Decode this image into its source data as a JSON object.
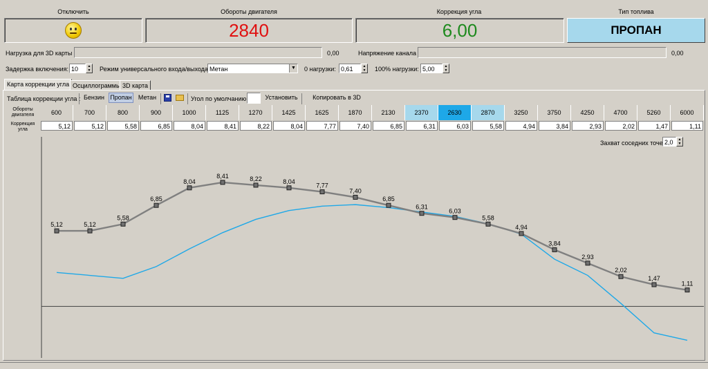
{
  "top": {
    "disable_label": "Отключить",
    "rpm_label": "Обороты двигателя",
    "rpm_value": "2840",
    "correction_label": "Коррекция угла",
    "correction_value": "6,00",
    "fuel_label": "Тип топлива",
    "fuel_value": "ПРОПАН"
  },
  "colors": {
    "rpm": "#e01010",
    "correction": "#1e8a1e",
    "fuel_bg": "#a6d8ec",
    "accent": "#1ea8e8",
    "curve_set": "#808080",
    "curve_actual": "#1ea8e8"
  },
  "load_row": {
    "load_label": "Нагрузка для 3D карты",
    "load_value": "0,00",
    "voltage_label": "Напряжение канала",
    "voltage_value": "0,00"
  },
  "settings_row": {
    "delay_label": "Задержка включения:",
    "delay_value": "10",
    "mode_label": "Режим универсального входа/выхода:",
    "mode_value": "Метан",
    "zero_load_label": "0 нагрузки:",
    "zero_load_value": "0,61",
    "full_load_label": "100% нагрузки:",
    "full_load_value": "5,00"
  },
  "tabs": [
    {
      "label": "Карта коррекции угла"
    },
    {
      "label": "Осциллограммы"
    },
    {
      "label": "3D карта"
    }
  ],
  "toolbar": {
    "table_label": "Таблица коррекции угла :",
    "petrol": "Бензин",
    "propane": "Пропан",
    "methane": "Метан",
    "default_angle_label": "Угол по умолчанию:",
    "set_button": "Установить",
    "copy_button": "Копировать в 3D карту"
  },
  "table": {
    "rpm_row_label": "Обороты двигателя",
    "corr_row_label": "Коррекция угла",
    "rpm": [
      "600",
      "700",
      "800",
      "900",
      "1000",
      "1125",
      "1270",
      "1425",
      "1625",
      "1870",
      "2130",
      "2370",
      "2630",
      "2870",
      "3250",
      "3750",
      "4250",
      "4700",
      "5260",
      "6000"
    ],
    "corr": [
      "5,12",
      "5,12",
      "5,58",
      "6,85",
      "8,04",
      "8,41",
      "8,22",
      "8,04",
      "7,77",
      "7,40",
      "6,85",
      "6,31",
      "6,03",
      "5,58",
      "4,94",
      "3,84",
      "2,93",
      "2,02",
      "1,47",
      "1,11"
    ],
    "highlighted": [
      11,
      13
    ],
    "selected": 12
  },
  "neighbor": {
    "label": "Захват соседних точек",
    "value": "2,0"
  },
  "chart_data": {
    "type": "line",
    "x": [
      "600",
      "700",
      "800",
      "900",
      "1000",
      "1125",
      "1270",
      "1425",
      "1625",
      "1870",
      "2130",
      "2370",
      "2630",
      "2870",
      "3250",
      "3750",
      "4250",
      "4700",
      "5260",
      "6000"
    ],
    "series": [
      {
        "values": [
          5.12,
          5.12,
          5.58,
          6.85,
          8.04,
          8.41,
          8.22,
          8.04,
          7.77,
          7.4,
          6.85,
          6.31,
          6.03,
          5.58,
          4.94,
          3.84,
          2.93,
          2.02,
          1.47,
          1.11
        ]
      },
      {
        "values": [
          2.3,
          2.1,
          1.9,
          2.7,
          3.9,
          5.0,
          5.9,
          6.5,
          6.8,
          6.9,
          6.7,
          6.4,
          6.1,
          5.6,
          4.9,
          3.2,
          2.1,
          0.2,
          -1.8,
          -2.3
        ]
      }
    ],
    "ylim": [
      -3.5,
      11.5
    ],
    "baseline": 0
  }
}
